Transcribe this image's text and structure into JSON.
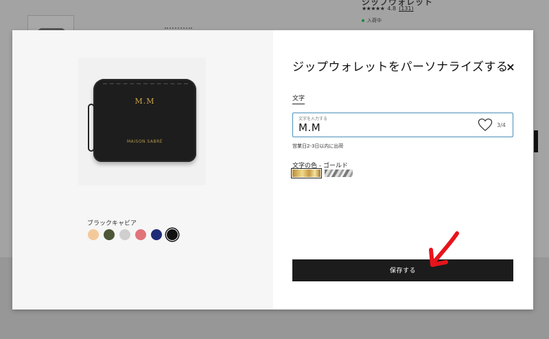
{
  "background": {
    "product_title": "ジップウォレット",
    "rating_stars": "★★★★★",
    "rating_value": "4.8",
    "rating_count": "(131)",
    "stock_status": "入荷中"
  },
  "product": {
    "wallet_initials": "M.M",
    "wallet_brand": "MAISON SABRÉ",
    "color_label": "ブラックキャビア",
    "colors": [
      "#f4c99a",
      "#4d5637",
      "#cfcfcf",
      "#e17479",
      "#1f2c78",
      "#111111"
    ],
    "selected_color_index": 5
  },
  "modal": {
    "title": "ジップウォレットをパーソナライズする",
    "close_icon": "×",
    "text_tab": "文字",
    "field_label": "文字を入力する",
    "field_value": "M.M",
    "char_count": "3/4",
    "delivery_note": "営業日2-3日以内に出荷",
    "metal_label": "文字の色 - ゴールド",
    "metals": [
      "gold",
      "silver"
    ],
    "selected_metal": "gold",
    "save_label": "保存する"
  },
  "annotation": {
    "arrow_color": "#e8141b"
  }
}
